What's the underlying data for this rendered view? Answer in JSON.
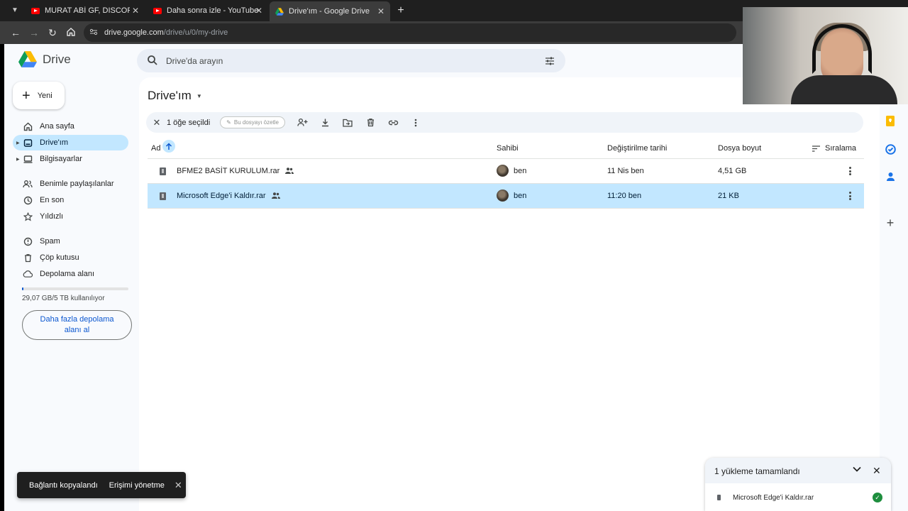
{
  "browser": {
    "tabs": [
      {
        "label": "MURAT ABİ GF, DISCORD'DAN",
        "favicon": "youtube-icon"
      },
      {
        "label": "Daha sonra izle - YouTube",
        "favicon": "youtube-icon"
      },
      {
        "label": "Drive'ım - Google Drive",
        "favicon": "drive-icon",
        "active": true
      }
    ],
    "url_host": "drive.google.com",
    "url_path": "/drive/u/0/my-drive"
  },
  "drive": {
    "logo_text": "Drive",
    "search_placeholder": "Drive'da arayın",
    "new_label": "Yeni",
    "nav": [
      {
        "label": "Ana sayfa",
        "icon": "home-icon"
      },
      {
        "label": "Drive'ım",
        "icon": "my-drive-icon",
        "active": true
      },
      {
        "label": "Bilgisayarlar",
        "icon": "computer-icon"
      },
      {
        "label": "Benimle paylaşılanlar",
        "icon": "shared-with-me-icon"
      },
      {
        "label": "En son",
        "icon": "clock-icon"
      },
      {
        "label": "Yıldızlı",
        "icon": "star-icon"
      },
      {
        "label": "Spam",
        "icon": "spam-icon"
      },
      {
        "label": "Çöp kutusu",
        "icon": "trash-icon"
      },
      {
        "label": "Depolama alanı",
        "icon": "cloud-icon"
      }
    ],
    "storage_text": "29,07 GB/5 TB kullanılıyor",
    "storage_fraction": 0.0057,
    "storage_button": "Daha fazla depolama alanı al",
    "page_title": "Drive'ım",
    "selection": {
      "count_text": "1 öğe seçildi",
      "summarize_label": "Bu dosyayı özetle"
    },
    "columns": {
      "name": "Ad",
      "owner": "Sahibi",
      "modified": "Değiştirilme tarihi",
      "size": "Dosya boyut",
      "sort": "Sıralama"
    },
    "files": [
      {
        "name": "BFME2 BASİT KURULUM.rar",
        "owner": "ben",
        "modified": "11 Nis ben",
        "size": "4,51 GB",
        "selected": false
      },
      {
        "name": "Microsoft Edge'i Kaldır.rar",
        "owner": "ben",
        "modified": "11:20 ben",
        "size": "21 KB",
        "selected": true
      }
    ]
  },
  "snackbar": {
    "message": "Bağlantı kopyalandı",
    "action": "Erişimi yönetme"
  },
  "upload": {
    "title": "1 yükleme tamamlandı",
    "file": "Microsoft Edge'i Kaldır.rar"
  },
  "colors": {
    "accent": "#0b57d0",
    "selected_row": "#c2e7ff",
    "success": "#1e8e3e"
  }
}
